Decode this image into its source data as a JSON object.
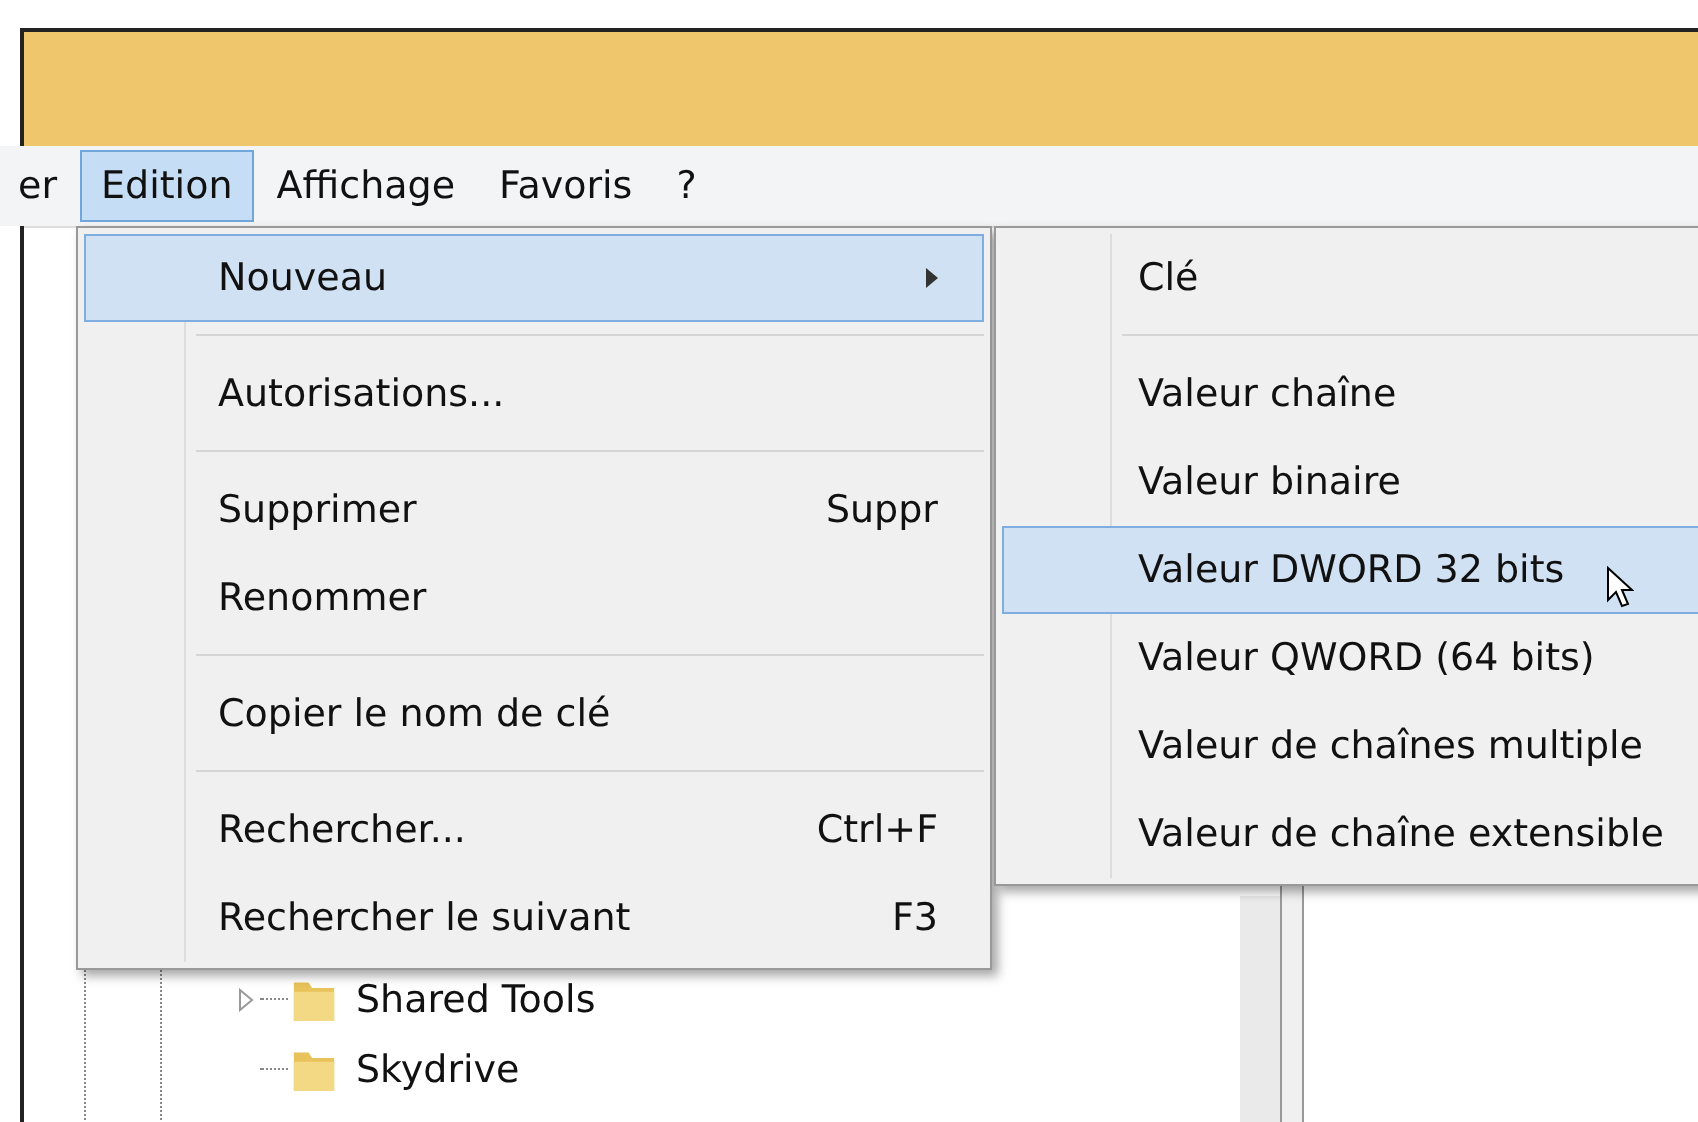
{
  "menubar": [
    {
      "label": "er",
      "selected": false
    },
    {
      "label": "Edition",
      "selected": true
    },
    {
      "label": "Affichage",
      "selected": false
    },
    {
      "label": "Favoris",
      "selected": false
    },
    {
      "label": "?",
      "selected": false
    }
  ],
  "edit_menu": [
    {
      "kind": "item",
      "label": "Nouveau",
      "submenu": true,
      "selected": true
    },
    {
      "kind": "separator"
    },
    {
      "kind": "item",
      "label": "Autorisations...",
      "selected": false
    },
    {
      "kind": "separator"
    },
    {
      "kind": "item",
      "label": "Supprimer",
      "shortcut": "Suppr",
      "selected": false
    },
    {
      "kind": "item",
      "label": "Renommer",
      "selected": false
    },
    {
      "kind": "separator"
    },
    {
      "kind": "item",
      "label": "Copier le nom de clé",
      "selected": false
    },
    {
      "kind": "separator"
    },
    {
      "kind": "item",
      "label": "Rechercher...",
      "shortcut": "Ctrl+F",
      "selected": false
    },
    {
      "kind": "item",
      "label": "Rechercher le suivant",
      "shortcut": "F3",
      "selected": false
    }
  ],
  "new_submenu": [
    {
      "kind": "item",
      "label": "Clé",
      "selected": false
    },
    {
      "kind": "separator"
    },
    {
      "kind": "item",
      "label": "Valeur chaîne",
      "selected": false
    },
    {
      "kind": "item",
      "label": "Valeur binaire",
      "selected": false
    },
    {
      "kind": "item",
      "label": "Valeur DWORD 32 bits",
      "selected": true
    },
    {
      "kind": "item",
      "label": "Valeur QWORD (64 bits)",
      "selected": false
    },
    {
      "kind": "item",
      "label": "Valeur de chaînes multiple",
      "selected": false
    },
    {
      "kind": "item",
      "label": "Valeur de chaîne extensible",
      "selected": false
    }
  ],
  "tree": [
    {
      "label": "Shared Tools",
      "expanded": false
    },
    {
      "label": "Skydrive"
    }
  ]
}
